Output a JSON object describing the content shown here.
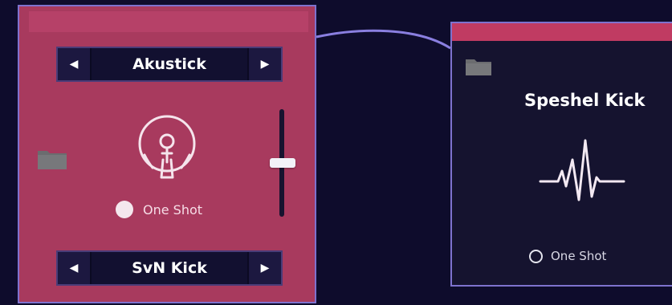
{
  "left_panel": {
    "top_selector": {
      "prev_icon": "left-triangle-icon",
      "value": "Akustick",
      "next_icon": "right-triangle-icon"
    },
    "bottom_selector": {
      "prev_icon": "left-triangle-icon",
      "value": "SvN Kick",
      "next_icon": "right-triangle-icon"
    },
    "folder_icon": "folder-icon",
    "instrument_icon": "kick-drum-icon",
    "one_shot": {
      "label": "One Shot",
      "checked": true
    },
    "volume_slider": {
      "value": 0.5
    }
  },
  "right_panel": {
    "folder_icon": "folder-icon",
    "title": "Speshel Kick",
    "instrument_icon": "waveform-icon",
    "one_shot": {
      "label": "One Shot",
      "checked": false
    }
  },
  "colors": {
    "background": "#0e0c2c",
    "left_panel": "#a83a5e",
    "right_panel": "#15132f",
    "accent_bar": "#c03b62",
    "border": "#7e72ce"
  }
}
